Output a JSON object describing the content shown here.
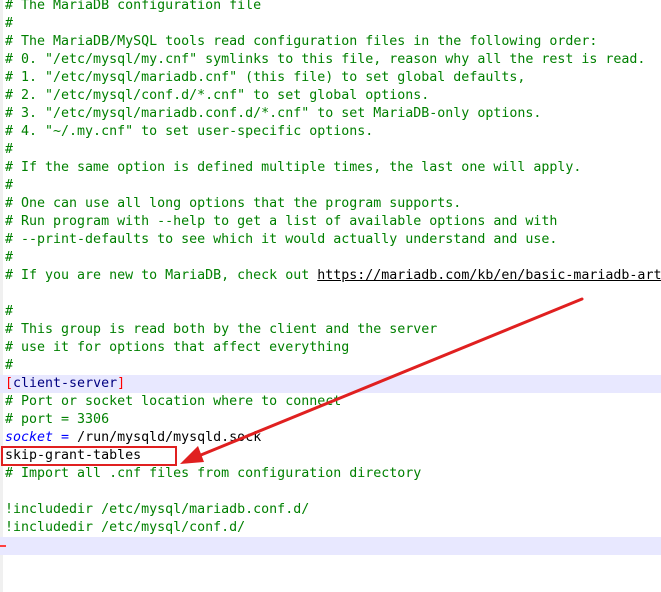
{
  "editor": {
    "lines": [
      "# The MariaDB configuration file",
      "#",
      "# The MariaDB/MySQL tools read configuration files in the following order:",
      "# 0. \"/etc/mysql/my.cnf\" symlinks to this file, reason why all the rest is read.",
      "# 1. \"/etc/mysql/mariadb.cnf\" (this file) to set global defaults,",
      "# 2. \"/etc/mysql/conf.d/*.cnf\" to set global options.",
      "# 3. \"/etc/mysql/mariadb.conf.d/*.cnf\" to set MariaDB-only options.",
      "# 4. \"~/.my.cnf\" to set user-specific options.",
      "#",
      "# If the same option is defined multiple times, the last one will apply.",
      "#",
      "# One can use all long options that the program supports.",
      "# Run program with --help to get a list of available options and with",
      "# --print-defaults to see which it would actually understand and use.",
      "#",
      "# If you are new to MariaDB, check out ",
      "",
      "#",
      "# This group is read both by the client and the server",
      "# use it for options that affect everything",
      "#",
      "[client-server]",
      "# Port or socket location where to connect",
      "# port = 3306",
      "socket",
      "skip-grant-tables",
      "# Import all .cnf files from configuration directory",
      "",
      "!includedir /etc/mysql/mariadb.conf.d/",
      "!includedir /etc/mysql/conf.d/",
      ""
    ],
    "url_text": "https://mariadb.com/kb/en/basic-mariadb-articles/",
    "socket_operator": " = ",
    "socket_value": "/run/mysqld/mysqld.sock",
    "section_name": "client-server"
  },
  "colors": {
    "comment": "#008000",
    "keyword": "#0000ff",
    "highlight_box": "#e02020",
    "arrow": "#e02020",
    "current_line": "#e8e8ff"
  }
}
